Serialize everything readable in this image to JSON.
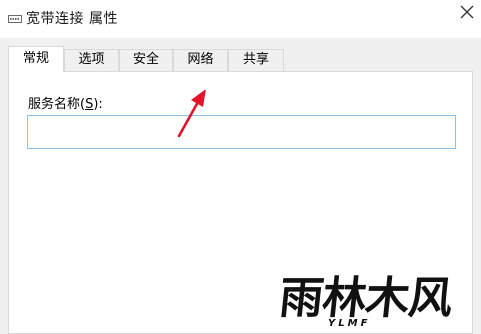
{
  "window": {
    "title": "宽带连接 属性",
    "close_glyph": "✕"
  },
  "tabs": [
    {
      "label": "常规",
      "active": true
    },
    {
      "label": "选项",
      "active": false
    },
    {
      "label": "安全",
      "active": false
    },
    {
      "label": "网络",
      "active": false
    },
    {
      "label": "共享",
      "active": false
    }
  ],
  "general": {
    "service_name_label_prefix": "服务名称(",
    "service_name_hotkey": "S",
    "service_name_label_suffix": "):",
    "service_name_value": ""
  },
  "annotation": {
    "arrow_color": "#e0142a"
  },
  "watermark": {
    "text": "雨林木风",
    "subtext": "YLMF"
  },
  "colors": {
    "input_border": "#8fbfe8",
    "dialog_bg": "#f0f0f0"
  }
}
